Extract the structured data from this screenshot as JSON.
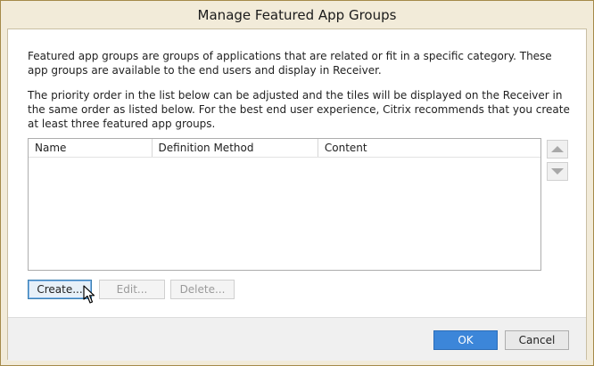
{
  "window": {
    "title": "Manage Featured App Groups"
  },
  "description": {
    "paragraph1": "Featured app groups are groups of applications that are related or fit in a specific category. These app groups are available to the end users and display in Receiver.",
    "paragraph2": "The priority order in the list below can be adjusted and the tiles will be displayed on the Receiver in the same order as listed below. For the best end user experience, Citrix recommends that you create at least three featured app groups."
  },
  "list": {
    "columns": [
      "Name",
      "Definition Method",
      "Content"
    ],
    "rows": []
  },
  "reorder": {
    "up_icon": "triangle-up-icon",
    "down_icon": "triangle-down-icon"
  },
  "actions": {
    "create_label": "Create...",
    "edit_label": "Edit...",
    "delete_label": "Delete..."
  },
  "footer": {
    "ok_label": "OK",
    "cancel_label": "Cancel"
  },
  "colors": {
    "window_frame": "#f2ebd9",
    "ok_button": "#3c86d9",
    "focus_border": "#3c7fb1"
  }
}
